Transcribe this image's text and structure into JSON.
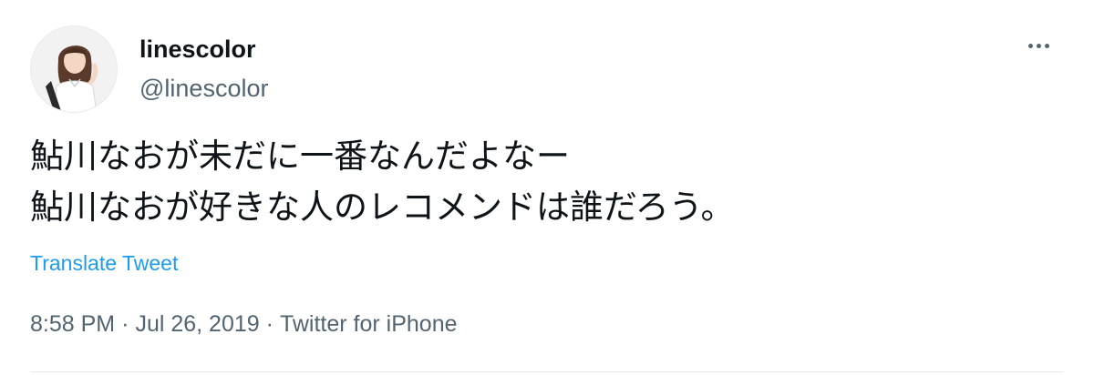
{
  "tweet": {
    "author": {
      "display_name": "linescolor",
      "handle": "@linescolor",
      "avatar_icon": "user-photo-avatar"
    },
    "more_icon": "more-horizontal-icon",
    "text_lines": [
      "鮎川なおが未だに一番なんだよなー",
      "鮎川なおが好きな人のレコメンドは誰だろう。"
    ],
    "translate_label": "Translate Tweet",
    "meta": {
      "time": "8:58 PM",
      "separator": "·",
      "date": "Jul 26, 2019",
      "source": "Twitter for iPhone"
    },
    "colors": {
      "text": "#0f1419",
      "secondary": "#536471",
      "link": "#1d9bf0",
      "divider": "#e7e9ea"
    }
  }
}
